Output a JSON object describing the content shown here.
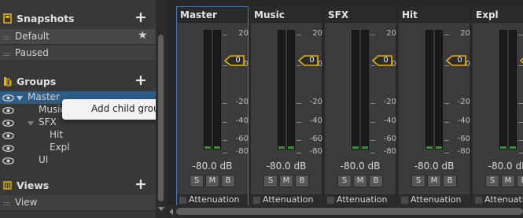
{
  "left": {
    "snapshots": {
      "title": "Snapshots",
      "add": "+",
      "items": [
        {
          "label": "Default",
          "star": "★"
        },
        {
          "label": "Paused",
          "star": ""
        }
      ]
    },
    "groups": {
      "title": "Groups",
      "add": "+",
      "items": [
        {
          "label": "Master",
          "level": 0,
          "expandable": true,
          "selected": true
        },
        {
          "label": "Music",
          "level": 1,
          "expandable": false,
          "selected": false
        },
        {
          "label": "SFX",
          "level": 1,
          "expandable": true,
          "selected": false
        },
        {
          "label": "Hit",
          "level": 2,
          "expandable": false,
          "selected": false
        },
        {
          "label": "Expl",
          "level": 2,
          "expandable": false,
          "selected": false
        },
        {
          "label": "UI",
          "level": 1,
          "expandable": false,
          "selected": false
        }
      ]
    },
    "views": {
      "title": "Views",
      "add": "+",
      "items": [
        {
          "label": "View"
        }
      ]
    },
    "context_menu": {
      "item": "Add child group"
    }
  },
  "mixer": {
    "scale": [
      "20",
      "0",
      "-20",
      "-40",
      "-60",
      "-80"
    ],
    "strips": [
      {
        "name": "Master",
        "fader": "0",
        "db": "-80.0 dB",
        "s": "S",
        "m": "M",
        "b": "B",
        "attenuation": "Attenuation",
        "selected": true
      },
      {
        "name": "Music",
        "fader": "0",
        "db": "-80.0 dB",
        "s": "S",
        "m": "M",
        "b": "B",
        "attenuation": "Attenuation",
        "selected": false
      },
      {
        "name": "SFX",
        "fader": "0",
        "db": "-80.0 dB",
        "s": "S",
        "m": "M",
        "b": "B",
        "attenuation": "Attenuation",
        "selected": false
      },
      {
        "name": "Hit",
        "fader": "0",
        "db": "-80.0 dB",
        "s": "S",
        "m": "M",
        "b": "B",
        "attenuation": "Attenuation",
        "selected": false
      },
      {
        "name": "Expl",
        "fader": "0",
        "db": "-80.0 dB",
        "s": "S",
        "m": "M",
        "b": "B",
        "attenuation": "Attenuation",
        "selected": false
      }
    ]
  },
  "colors": {
    "accent": "#e8b200",
    "selection": "#2c5d87",
    "meter_green": "#3f8a3a"
  }
}
